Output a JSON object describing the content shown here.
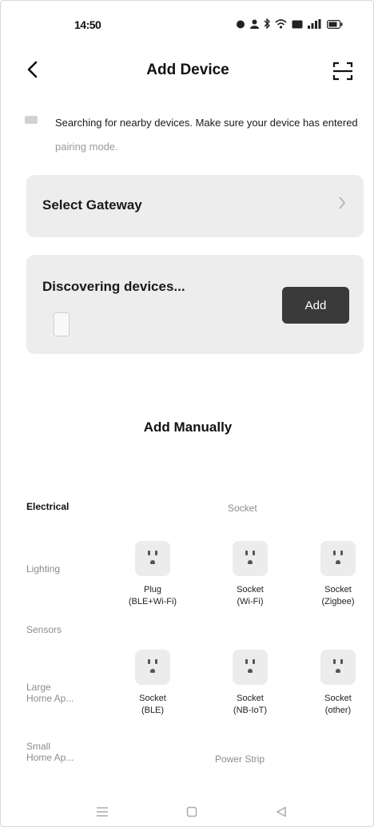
{
  "status_bar": {
    "time": "14:50",
    "icons": [
      "alarm-icon",
      "person-icon",
      "bluetooth-icon",
      "wifi-icon",
      "screen-icon",
      "signal-icon",
      "battery-icon"
    ]
  },
  "header": {
    "title": "Add Device",
    "back_icon": "chevron-left-icon",
    "scan_icon": "scan-icon"
  },
  "notice": {
    "text": "Searching for nearby devices. Make sure your device has entered ",
    "link": "pairing mode."
  },
  "gateway": {
    "label": "Select Gateway"
  },
  "discover": {
    "label": "Discovering devices...",
    "add_label": "Add"
  },
  "manual": {
    "title": "Add Manually",
    "categories": [
      {
        "label": "Electrical",
        "active": true
      },
      {
        "label": "Lighting",
        "active": false
      },
      {
        "label": "Sensors",
        "active": false
      },
      {
        "label": "Large\nHome Ap...",
        "active": false
      },
      {
        "label": "Small\nHome Ap...",
        "active": false
      }
    ],
    "groups": [
      {
        "title": "Socket"
      },
      {
        "title": "Power Strip"
      }
    ],
    "devices": [
      {
        "label": "Plug\n(BLE+Wi-Fi)"
      },
      {
        "label": "Socket\n(Wi-Fi)"
      },
      {
        "label": "Socket\n(Zigbee)"
      },
      {
        "label": "Socket\n(BLE)"
      },
      {
        "label": "Socket\n(NB-IoT)"
      },
      {
        "label": "Socket\n(other)"
      }
    ]
  },
  "nav": {
    "icons": [
      "menu-icon",
      "home-square-icon",
      "back-triangle-icon"
    ]
  },
  "colors": {
    "card_bg": "#ededed",
    "button_bg": "#3a3a3a",
    "muted_text": "#8c8c8c"
  }
}
